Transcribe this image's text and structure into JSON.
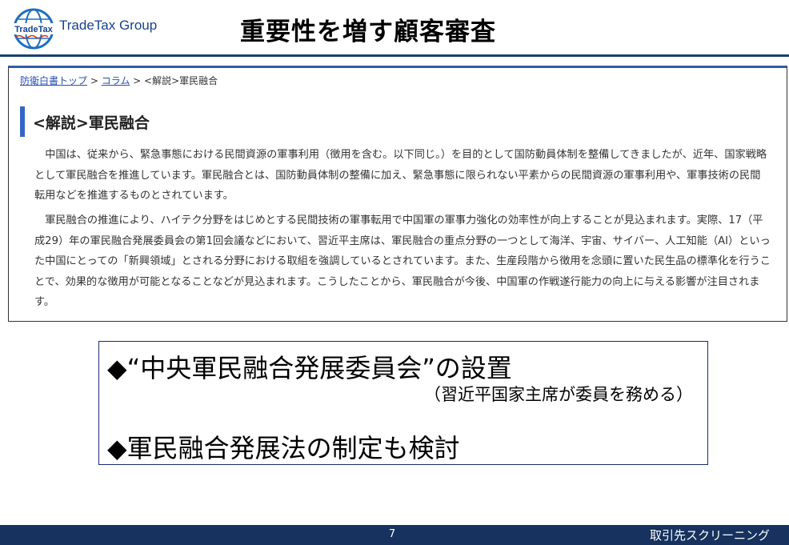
{
  "header": {
    "logo_text": "TradeTax Group",
    "logo_globe_text": "TradeTax",
    "title": "重要性を増す顧客審査"
  },
  "screenshot": {
    "breadcrumb": {
      "home": "防衛白書トップ",
      "sep1": " > ",
      "column": "コラム",
      "sep2": " > ",
      "current": "<解説>軍民融合"
    },
    "section_title": "<解説>軍民融合",
    "paragraphs": [
      "中国は、従来から、緊急事態における民間資源の軍事利用（徴用を含む。以下同じ。）を目的として国防動員体制を整備してきましたが、近年、国家戦略として軍民融合を推進しています。軍民融合とは、国防動員体制の整備に加え、緊急事態に限られない平素からの民間資源の軍事利用や、軍事技術の民間転用などを推進するものとされています。",
      "軍民融合の推進により、ハイテク分野をはじめとする民間技術の軍事転用で中国軍の軍事力強化の効率性が向上することが見込まれます。実際、17（平成29）年の軍民融合発展委員会の第1回会議などにおいて、習近平主席は、軍民融合の重点分野の一つとして海洋、宇宙、サイバー、人工知能（AI）といった中国にとっての「新興領域」とされる分野における取組を強調しているとされています。また、生産段階から徴用を念頭に置いた民生品の標準化を行うことで、効果的な徴用が可能となることなどが見込まれます。こうしたことから、軍民融合が今後、中国軍の作戦遂行能力の向上に与える影響が注目されます。"
    ]
  },
  "callout": {
    "point1": "◆“中央軍民融合発展委員会”の設置",
    "point1_note": "（習近平国家主席が委員を務める）",
    "point2": "◆軍民融合発展法の制定も検討"
  },
  "footer": {
    "page_number": "7",
    "label": "取引先スクリーニング"
  },
  "colors": {
    "navy": "#17325e",
    "accent_blue": "#3465c8",
    "link_blue": "#2a4fb0"
  }
}
